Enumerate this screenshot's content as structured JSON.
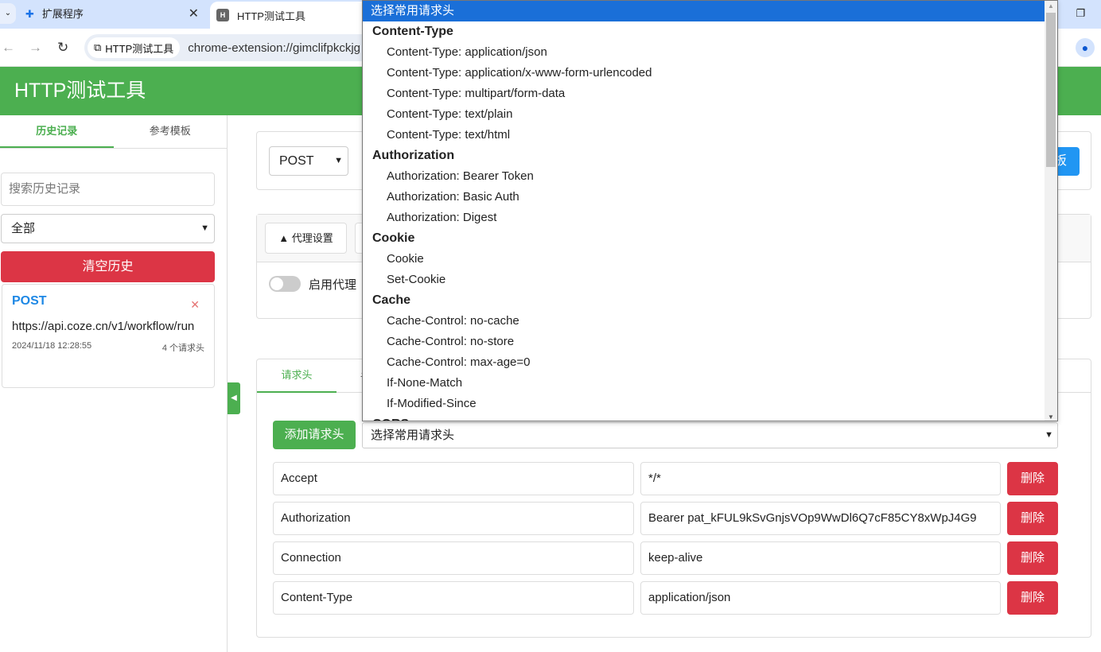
{
  "browser": {
    "tabs": [
      {
        "title": "扩展程序",
        "icon": "puzzle-icon"
      },
      {
        "title": "HTTP测试工具",
        "favicon": "H"
      }
    ],
    "site_chip": "HTTP测试工具",
    "url": "chrome-extension://gimclifpkckjg"
  },
  "app": {
    "title": "HTTP测试工具",
    "accent": "#4caf50"
  },
  "sidebar": {
    "tabs": [
      "历史记录",
      "参考模板"
    ],
    "search_placeholder": "搜索历史记录",
    "filter": "全部",
    "clear_label": "清空历史",
    "history": [
      {
        "method": "POST",
        "url": "https://api.coze.cn/v1/workflow/run",
        "time": "2024/11/18 12:28:55",
        "count": "4 个请求头"
      }
    ]
  },
  "request": {
    "method": "POST",
    "template_btn_partial": "板"
  },
  "proxy": {
    "toggle_label": "▲ 代理设置",
    "enable_label": "启用代理",
    "enabled": false
  },
  "tabs": {
    "active": "请求头",
    "second_partial": "请"
  },
  "headers": {
    "add_label": "添加请求头",
    "select_value": "选择常用请求头",
    "delete_label": "删除",
    "rows": [
      {
        "key": "Accept",
        "value": "*/*"
      },
      {
        "key": "Authorization",
        "value": "Bearer pat_kFUL9kSvGnjsVOp9WwDl6Q7cF85CY8xWpJ4G9"
      },
      {
        "key": "Connection",
        "value": "keep-alive"
      },
      {
        "key": "Content-Type",
        "value": "application/json"
      }
    ]
  },
  "dropdown": {
    "selected": "选择常用请求头",
    "groups": [
      {
        "label": "Content-Type",
        "options": [
          "Content-Type: application/json",
          "Content-Type: application/x-www-form-urlencoded",
          "Content-Type: multipart/form-data",
          "Content-Type: text/plain",
          "Content-Type: text/html"
        ]
      },
      {
        "label": "Authorization",
        "options": [
          "Authorization: Bearer Token",
          "Authorization: Basic Auth",
          "Authorization: Digest"
        ]
      },
      {
        "label": "Cookie",
        "options": [
          "Cookie",
          "Set-Cookie"
        ]
      },
      {
        "label": "Cache",
        "options": [
          "Cache-Control: no-cache",
          "Cache-Control: no-store",
          "Cache-Control: max-age=0",
          "If-None-Match",
          "If-Modified-Since"
        ]
      },
      {
        "label": "CORS",
        "options": []
      }
    ]
  }
}
